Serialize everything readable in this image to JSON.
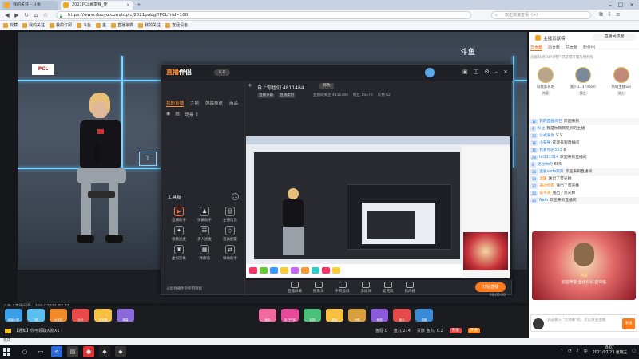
{
  "browser": {
    "tabs": [
      {
        "label": "我的关注 - 斗鱼",
        "active": false
      },
      {
        "label": "2021PCL夏季赛_使",
        "active": true
      }
    ],
    "new_tab_icon": "plus-icon",
    "url": "https://www.douyu.com/topic/2021pubgl?PCL?rid=100",
    "search_placeholder": "双击快速查看（+）",
    "bookmarks": [
      "收藏",
      "我的关注",
      "我的订阅",
      "斗鱼",
      "金",
      "直播争霸",
      "我的关注",
      "查经设备"
    ]
  },
  "stage": {
    "brand": "斗鱼",
    "logo_text": "PCL",
    "info": "斗鱼 | 直播间号：100 | 2021.07.23",
    "side_video_label": "T"
  },
  "app": {
    "name_cn": "直播",
    "name_rest": "伴侣",
    "version": "6.0",
    "tabs": [
      "我的直播",
      "主题",
      "弹幕推送",
      "商品"
    ],
    "scene_title": "场景 1",
    "room_title": "自上你也们 4811484",
    "room_edit": "修改",
    "tags": [
      "直播争霸",
      "直播类别"
    ],
    "stats": [
      "直播间关注 4811484",
      "粉丝 19270",
      "礼物 62"
    ],
    "tools_title": "工具箱",
    "tools": [
      {
        "label": "直播助手",
        "hot": true
      },
      {
        "label": "弹幕助手",
        "hot": false
      },
      {
        "label": "主播信息",
        "hot": false
      },
      {
        "label": "视频连麦",
        "hot": false
      },
      {
        "label": "多人连麦",
        "hot": false
      },
      {
        "label": "道具配置",
        "hot": false
      },
      {
        "label": "虚拟形象",
        "hot": false
      },
      {
        "label": "弹幕墙",
        "hot": false
      },
      {
        "label": "联动助手",
        "hot": false
      }
    ],
    "tools_footer": "斗鱼直播伴侣使用教程",
    "bottom_tools": [
      "直播屏幕",
      "摄像头",
      "手机投屏",
      "多媒体",
      "麦克风",
      "扬声器"
    ],
    "start_label": "开始直播",
    "timer": "00:00:00"
  },
  "chat": {
    "rank_title": "主播贡献榜",
    "live_label": "直播间热度",
    "tabs": [
      "日贡献",
      "周贡献",
      "总贡献",
      "粉丝团"
    ],
    "note": "贡献日榜TOP3用户可获得专属礼物特权",
    "top3": [
      {
        "name": "叫我家长吧",
        "badge": "神豪"
      },
      {
        "name": "爱川11374680",
        "badge": "霸主"
      },
      {
        "name": "热情主播Sio",
        "badge": "骑士"
      }
    ],
    "messages": [
      {
        "lv": "12",
        "name": "我的直播间已",
        "text": "欢迎来到",
        "style": "sys"
      },
      {
        "lv": "9",
        "name": "粉丝",
        "text": "我是你刚刚见到的主播",
        "style": ""
      },
      {
        "lv": "33",
        "name": "公式爱你",
        "text": "V V",
        "style": ""
      },
      {
        "lv": "16",
        "name": "小猫咪",
        "text": "欢迎来到直播间",
        "style": ""
      },
      {
        "lv": "15",
        "name": "我爱你的553",
        "text": "6",
        "style": ""
      },
      {
        "lv": "28",
        "name": "lol211314",
        "text": "欢迎来到直播间",
        "style": ""
      },
      {
        "lv": "6",
        "name": "通过你的",
        "text": "666",
        "style": ""
      },
      {
        "lv": "36",
        "name": "追爱sada家家",
        "text": "欢迎来到直播间",
        "style": "sys"
      },
      {
        "lv": "24",
        "name": "温暖",
        "text": "送出了荧光棒",
        "style": "orange"
      },
      {
        "lv": "37",
        "name": "通过你的",
        "text": "送出了荧光棒",
        "style": "orange"
      },
      {
        "lv": "33",
        "name": "说不哭",
        "text": "送出了荧光棒",
        "style": "orange"
      },
      {
        "lv": "32",
        "name": "Nain",
        "text": "欢迎来到直播间",
        "style": "sys"
      }
    ],
    "rank_card_name": "神豪",
    "rank_card_text": "欢迎神豪 全场尖叫 迎驾临",
    "input_placeholder": "说说聊入  \"大弹幕\"吧，可以发送主播",
    "send_label": "发送"
  },
  "giftbar": {
    "gifts": [
      "超级火箭",
      "飞机",
      "大宝剑",
      "办卡",
      "荧光棒",
      "弹幕",
      "鱼丸",
      "告白气球",
      "礼物",
      "魔法",
      "小鸭",
      "鱼翅",
      "鱼丸",
      "游艇"
    ],
    "notice": "【通知】你可领取火箭X1",
    "balance": [
      "鱼翅 0",
      "鱼丸 214"
    ],
    "pay_labels": [
      "充值",
      "开通"
    ],
    "level": "贵族 鱼丸: 0.2"
  },
  "statusbar": {
    "text": "完成"
  },
  "taskbar": {
    "time": "8:07",
    "date": "2021/07/23 星期五",
    "lang": "中"
  }
}
